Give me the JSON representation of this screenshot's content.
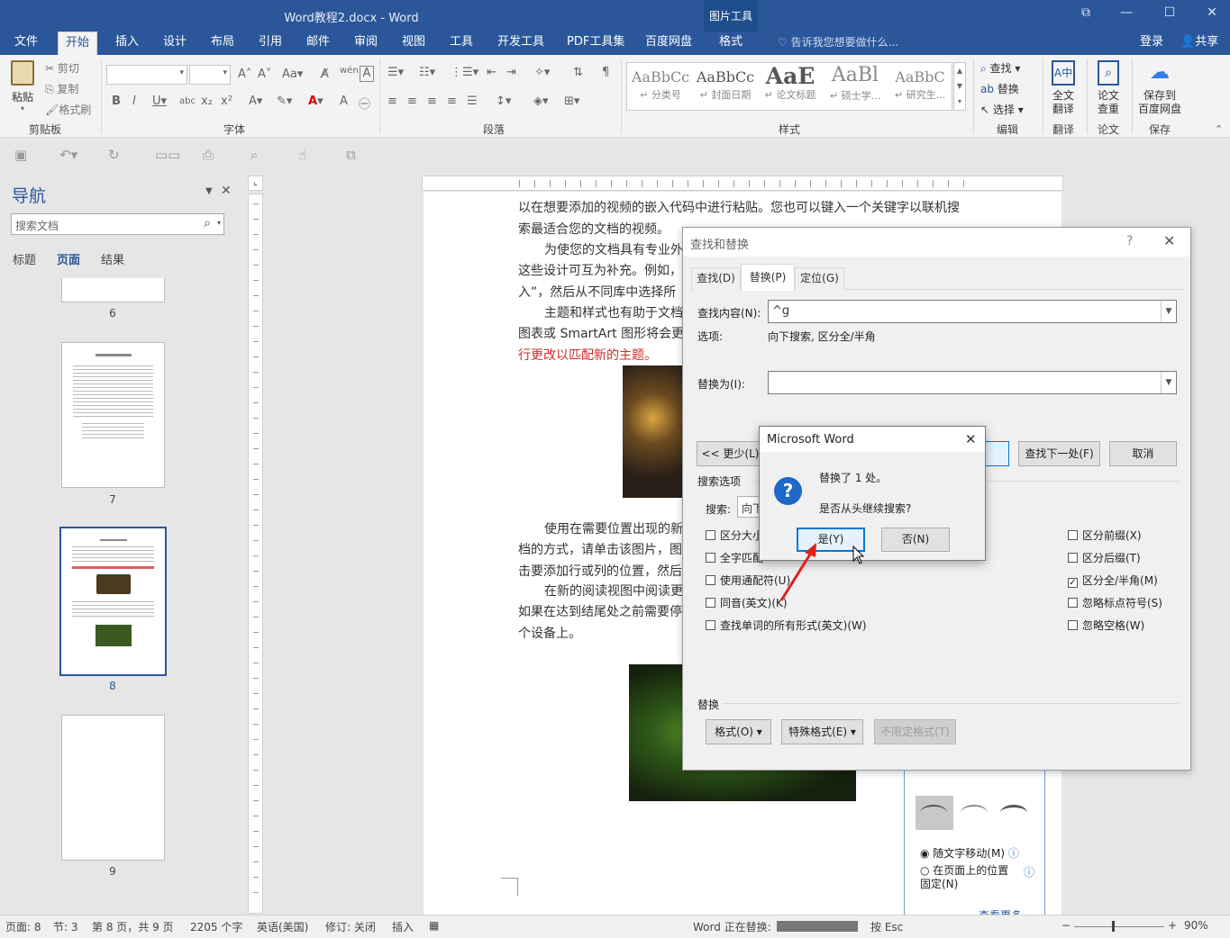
{
  "window": {
    "title": "Word教程2.docx - Word",
    "context_tool": "图片工具",
    "min_icon": "minimize-icon",
    "restore_icon": "restore-icon"
  },
  "tabs": [
    "文件",
    "开始",
    "插入",
    "设计",
    "布局",
    "引用",
    "邮件",
    "审阅",
    "视图",
    "工具",
    "开发工具",
    "PDF工具集",
    "百度网盘",
    "格式"
  ],
  "tellme": "告诉我您想要做什么...",
  "login": "登录",
  "share": "共享",
  "ribbon": {
    "clipboard": {
      "paste": "粘贴",
      "cut": "剪切",
      "copy": "复制",
      "format_painter": "格式刷",
      "label": "剪贴板"
    },
    "font": {
      "label": "字体"
    },
    "paragraph": {
      "label": "段落"
    },
    "styles": {
      "label": "样式",
      "items": [
        {
          "preview": "AaBbCc",
          "name": "↵ 分类号"
        },
        {
          "preview": "AaBbCc",
          "name": "↵ 封面日期"
        },
        {
          "preview": "AaE",
          "name": "↵ 论文标题"
        },
        {
          "preview": "AaBl",
          "name": "↵ 硕士学..."
        },
        {
          "preview": "AaBbC",
          "name": "↵ 研究生..."
        }
      ]
    },
    "editing": {
      "find": "查找",
      "replace": "替换",
      "select": "选择",
      "label": "编辑"
    },
    "translate": {
      "button": "全文\n翻译",
      "label": "翻译"
    },
    "paper": {
      "button": "论文\n查重",
      "label": "论文"
    },
    "save": {
      "button": "保存到\n百度网盘",
      "label": "保存"
    }
  },
  "nav": {
    "title": "导航",
    "search_placeholder": "搜索文档",
    "tabs": [
      "标题",
      "页面",
      "结果"
    ],
    "pages": [
      "6",
      "7",
      "8",
      "9"
    ]
  },
  "document": {
    "lines": [
      "以在想要添加的视频的嵌入代码中进行粘贴。您也可以键入一个关键字以联机搜",
      "索最适合您的文档的视频。",
      "为使您的文档具有专业外",
      "这些设计可互为补充。例如，",
      "入”，然后从不同库中选择所",
      "主题和样式也有助于文档",
      "图表或 SmartArt 图形将会更",
      "行更改以匹配新的主题。",
      "使用在需要位置出现的新",
      "档的方式，请单击该图片，图",
      "击要添加行或列的位置，然后",
      "在新的阅读视图中阅读更",
      "如果在达到结尾处之前需要停",
      "个设备上。"
    ]
  },
  "find_replace": {
    "title": "查找和替换",
    "help": "?",
    "tabs": [
      "查找(D)",
      "替换(P)",
      "定位(G)"
    ],
    "find_label": "查找内容(N):",
    "find_value": "^g",
    "options_label": "选项:",
    "options_value": "向下搜索, 区分全/半角",
    "replace_label": "替换为(I):",
    "replace_value": "",
    "less_button": "<< 更少(L)",
    "find_next": "查找下一处(F)",
    "cancel": "取消",
    "search_options": "搜索选项",
    "search_label": "搜索:",
    "search_value": "向下",
    "left_checks": [
      {
        "label": "区分大小",
        "checked": false
      },
      {
        "label": "全字匹配",
        "checked": false
      },
      {
        "label": "使用通配符(U)",
        "checked": false
      },
      {
        "label": "同音(英文)(K)",
        "checked": false
      },
      {
        "label": "查找单词的所有形式(英文)(W)",
        "checked": false
      }
    ],
    "right_checks": [
      {
        "label": "区分前缀(X)",
        "checked": false
      },
      {
        "label": "区分后缀(T)",
        "checked": false
      },
      {
        "label": "区分全/半角(M)",
        "checked": true
      },
      {
        "label": "忽略标点符号(S)",
        "checked": false
      },
      {
        "label": "忽略空格(W)",
        "checked": false
      }
    ],
    "replace_section": "替换",
    "format_btn": "格式(O) ▾",
    "special_btn": "特殊格式(E) ▾",
    "no_format_btn": "不限定格式(T)"
  },
  "msgbox": {
    "title": "Microsoft Word",
    "line1": "替换了 1 处。",
    "line2": "是否从头继续搜索?",
    "yes": "是(Y)",
    "no": "否(N)"
  },
  "layout_panel": {
    "move_with_text": "随文字移动(M)",
    "fixed_position": "在页面上的位置\n固定(N)",
    "see_more": "查看更多..."
  },
  "status": {
    "page": "页面: 8",
    "section": "节: 3",
    "page_of": "第 8 页，共 9 页",
    "words": "2205 个字",
    "language": "英语(美国)",
    "track": "修订: 关闭",
    "insert": "插入",
    "replacing": "Word 正在替换:",
    "esc": "按 Esc",
    "zoom": "90%"
  },
  "colors": {
    "accent": "#2b579a",
    "red_text": "#d12b2b",
    "arrow": "#e01f1f"
  }
}
